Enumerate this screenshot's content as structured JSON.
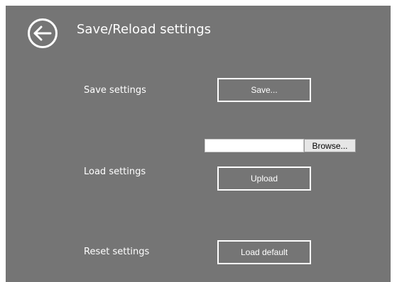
{
  "header": {
    "back_icon": "arrow-left-circle-icon",
    "title": "Save/Reload settings"
  },
  "save_section": {
    "label": "Save settings",
    "button_label": "Save..."
  },
  "load_section": {
    "label": "Load settings",
    "file_field_value": "",
    "browse_label": "Browse...",
    "upload_label": "Upload"
  },
  "reset_section": {
    "label": "Reset settings",
    "button_label": "Load default"
  },
  "colors": {
    "panel_background": "#757575",
    "foreground": "#ffffff"
  }
}
